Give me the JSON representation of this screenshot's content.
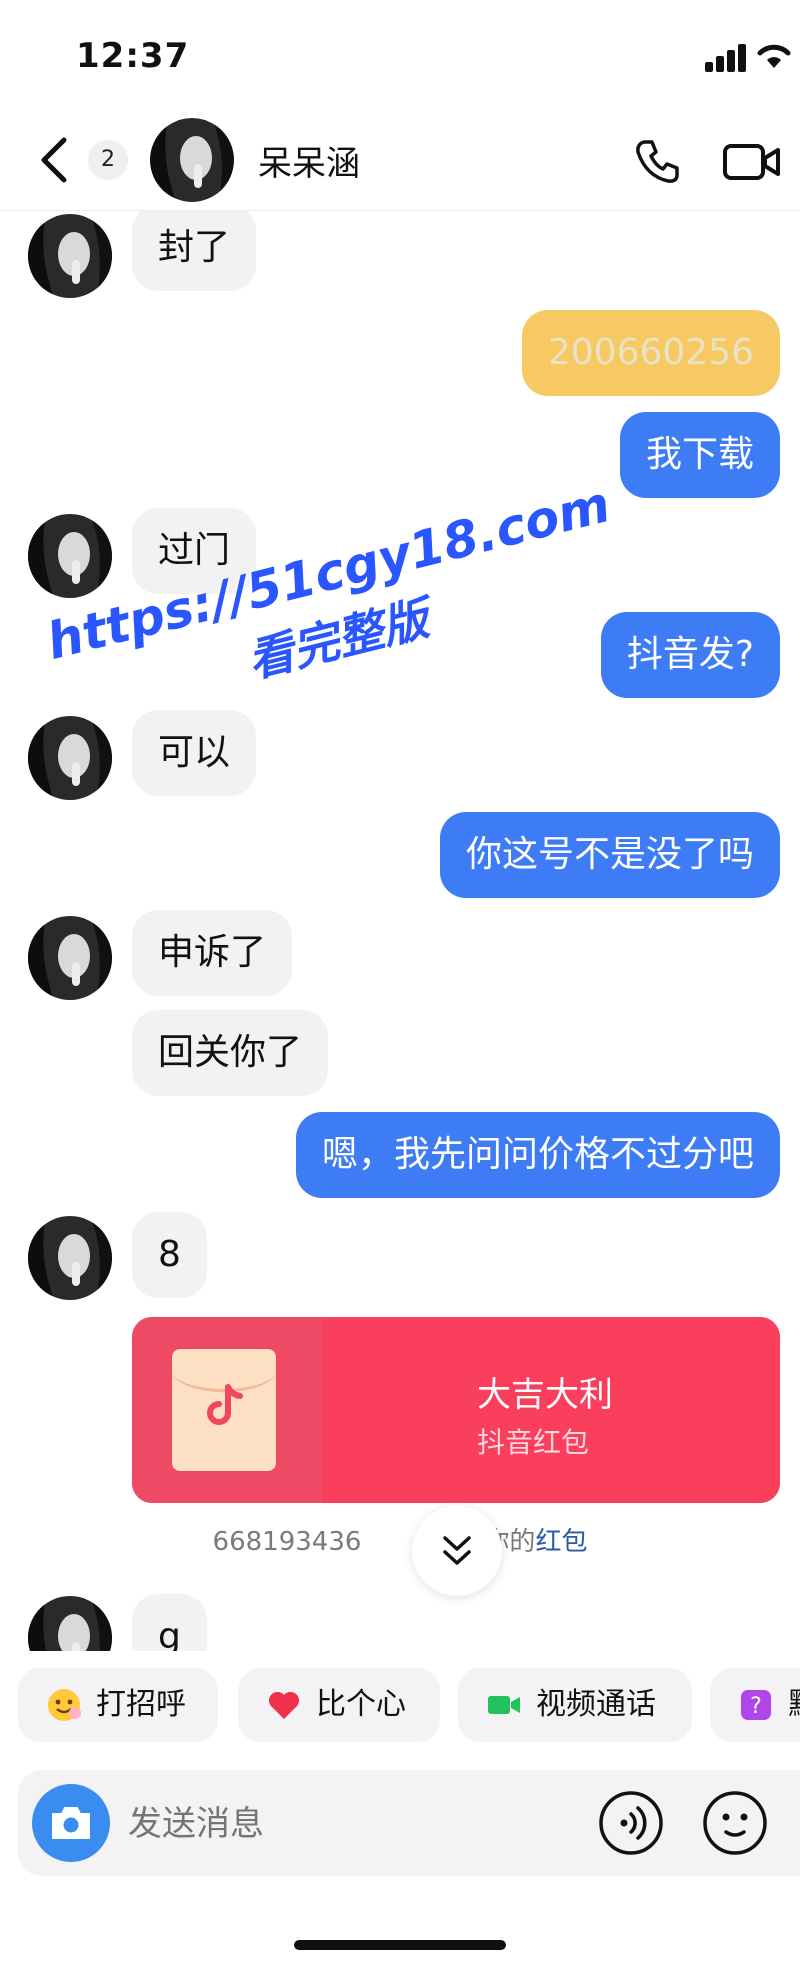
{
  "status_bar": {
    "time": "12:37"
  },
  "header": {
    "unread_count": "2",
    "contact_name": "呆呆涵"
  },
  "watermark": {
    "line1": "https://51cgy18.com",
    "line2": "看完整版"
  },
  "messages": [
    {
      "side": "in",
      "text": "封了"
    },
    {
      "side": "out",
      "text": "200660256",
      "redacted": true
    },
    {
      "side": "out",
      "text": "我下载"
    },
    {
      "side": "in",
      "text": "过门"
    },
    {
      "side": "out",
      "text": "抖音发?"
    },
    {
      "side": "in",
      "text": "可以"
    },
    {
      "side": "out",
      "text": "你这号不是没了吗"
    },
    {
      "side": "in",
      "text": "申诉了"
    },
    {
      "side": "in",
      "text": "回关你了"
    },
    {
      "side": "out",
      "text": "嗯，我先问问价格不过分吧"
    },
    {
      "side": "in",
      "text": "8"
    },
    {
      "side": "in",
      "text": "g"
    }
  ],
  "red_packet": {
    "title": "大吉大利",
    "subtitle": "抖音红包"
  },
  "system_note": {
    "prefix": "668193436",
    "middle": "取了你的",
    "link": "红包"
  },
  "quick_replies": [
    {
      "icon": "wave-emoji-icon",
      "label": "打招呼"
    },
    {
      "icon": "heart-icon",
      "label": "比个心"
    },
    {
      "icon": "video-camera-icon",
      "label": "视频通话"
    },
    {
      "icon": "question-icon",
      "label": "默"
    }
  ],
  "input": {
    "placeholder": "发送消息"
  },
  "colors": {
    "outgoing": "#3d7cf4",
    "incoming": "#f2f2f4",
    "red_packet": "#fa3f5c"
  }
}
